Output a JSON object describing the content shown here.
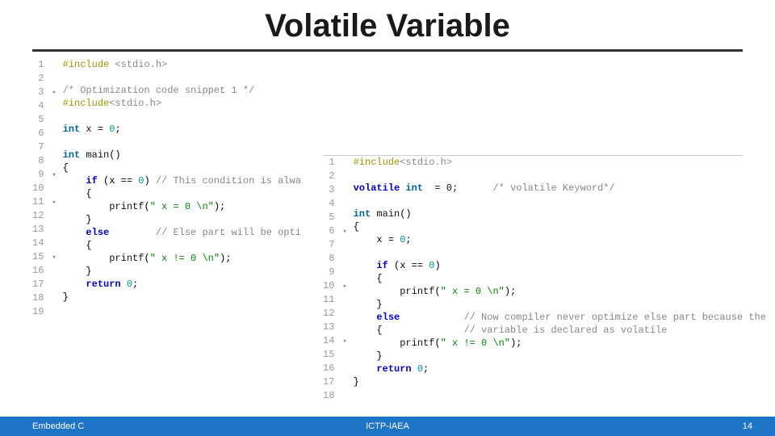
{
  "slide": {
    "title": "Volatile Variable",
    "footer_left": "Embedded C",
    "footer_center": "ICTP-IAEA",
    "footer_right": "14"
  },
  "code_left": {
    "lines": [
      {
        "n": "1",
        "fold": "",
        "html": "<span class='tok-pre'>#include</span> <span class='tok-cmnt'>&lt;stdio.h&gt;</span>"
      },
      {
        "n": "2",
        "fold": "",
        "html": ""
      },
      {
        "n": "3",
        "fold": "▾",
        "html": "<span class='tok-cmnt'>/* Optimization code snippet 1 */</span>"
      },
      {
        "n": "4",
        "fold": "",
        "html": "<span class='tok-pre'>#include</span><span class='tok-cmnt'>&lt;stdio.h&gt;</span>"
      },
      {
        "n": "5",
        "fold": "",
        "html": ""
      },
      {
        "n": "6",
        "fold": "",
        "html": "<span class='tok-type'>int</span> <span class='tok-id'>x</span> = <span class='tok-num'>0</span>;"
      },
      {
        "n": "7",
        "fold": "",
        "html": ""
      },
      {
        "n": "8",
        "fold": "",
        "html": "<span class='tok-type'>int</span> <span class='tok-id'>main</span>()"
      },
      {
        "n": "9",
        "fold": "▾",
        "html": "{"
      },
      {
        "n": "10",
        "fold": "",
        "html": "    <span class='tok-kw'>if</span> (x == <span class='tok-num'>0</span>) <span class='tok-cmnt'>// This condition is alwa</span>"
      },
      {
        "n": "11",
        "fold": "▾",
        "html": "    {"
      },
      {
        "n": "12",
        "fold": "",
        "html": "        <span class='tok-id'>printf</span>(<span class='tok-str'>\" x = 0 \\n\"</span>);"
      },
      {
        "n": "13",
        "fold": "",
        "html": "    }"
      },
      {
        "n": "14",
        "fold": "",
        "html": "    <span class='tok-kw'>else</span>        <span class='tok-cmnt'>// Else part will be opti</span>"
      },
      {
        "n": "15",
        "fold": "▾",
        "html": "    {"
      },
      {
        "n": "16",
        "fold": "",
        "html": "        <span class='tok-id'>printf</span>(<span class='tok-str'>\" x != 0 \\n\"</span>);"
      },
      {
        "n": "17",
        "fold": "",
        "html": "    }"
      },
      {
        "n": "18",
        "fold": "",
        "html": "    <span class='tok-kw'>return</span> <span class='tok-num'>0</span>;"
      },
      {
        "n": "19",
        "fold": "",
        "html": "}"
      }
    ]
  },
  "code_right": {
    "lines": [
      {
        "n": "1",
        "fold": "",
        "html": "<span class='tok-pre'>#include</span><span class='tok-cmnt'>&lt;stdio.h&gt;</span>"
      },
      {
        "n": "2",
        "fold": "",
        "html": ""
      },
      {
        "n": "3",
        "fold": "",
        "html": "<span class='tok-kw'>volatile</span> <span class='tok-type'>int</span> <span style='background:#fff;color:#111'> = 0;</span>      <span class='tok-cmnt'>/* volatile Keyword*/</span>"
      },
      {
        "n": "4",
        "fold": "",
        "html": ""
      },
      {
        "n": "5",
        "fold": "",
        "html": "<span class='tok-type'>int</span> <span class='tok-id'>main</span>()"
      },
      {
        "n": "6",
        "fold": "▾",
        "html": "{"
      },
      {
        "n": "7",
        "fold": "",
        "html": "    x = <span class='tok-num'>0</span>;"
      },
      {
        "n": "8",
        "fold": "",
        "html": ""
      },
      {
        "n": "9",
        "fold": "",
        "html": "    <span class='tok-kw'>if</span> (x == <span class='tok-num'>0</span>)"
      },
      {
        "n": "10",
        "fold": "▾",
        "html": "    {"
      },
      {
        "n": "11",
        "fold": "",
        "html": "        <span class='tok-id'>printf</span>(<span class='tok-str'>\" x = 0 \\n\"</span>);"
      },
      {
        "n": "12",
        "fold": "",
        "html": "    }"
      },
      {
        "n": "13",
        "fold": "",
        "html": "    <span class='tok-kw'>else</span>           <span class='tok-cmnt'>// Now compiler never optimize else part because the</span>"
      },
      {
        "n": "14",
        "fold": "▾",
        "html": "    {              <span class='tok-cmnt'>// variable is declared as volatile</span>"
      },
      {
        "n": "15",
        "fold": "",
        "html": "        <span class='tok-id'>printf</span>(<span class='tok-str'>\" x != 0 \\n\"</span>);"
      },
      {
        "n": "16",
        "fold": "",
        "html": "    }"
      },
      {
        "n": "17",
        "fold": "",
        "html": "    <span class='tok-kw'>return</span> <span class='tok-num'>0</span>;"
      },
      {
        "n": "18",
        "fold": "",
        "html": "}"
      }
    ]
  }
}
